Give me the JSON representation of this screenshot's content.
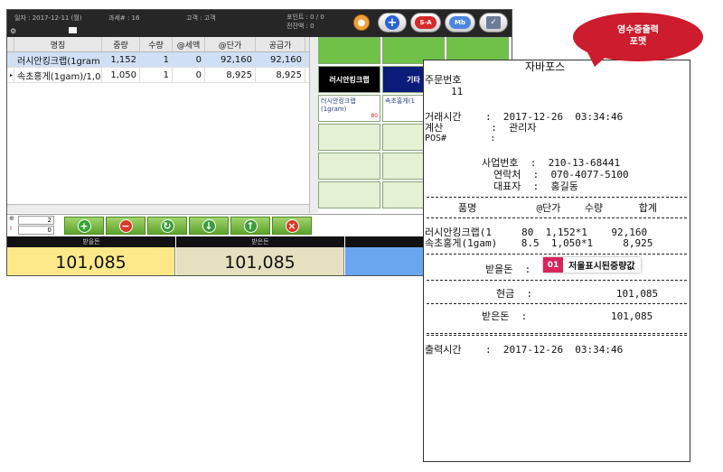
{
  "header": {
    "date_label": "일자 : 2017-12-11 (월)",
    "tax_label": "과세# : 16",
    "customer_label": "고객 : 고객",
    "points_label": "포인트 : 0 / 0",
    "prev_balance_label": "전잔액 : 0",
    "toolbar_sa": "S-A",
    "toolbar_mb": "Mb"
  },
  "table": {
    "columns": [
      "명칭",
      "중량",
      "수량",
      "@세액",
      "@단가",
      "공급가"
    ],
    "rows": [
      [
        "러시안킹크랩(1gram",
        "1,152",
        "1",
        "0",
        "92,160",
        "92,160"
      ],
      [
        "속초홍게(1gam)/1,0",
        "1,050",
        "1",
        "0",
        "8,925",
        "8,925"
      ]
    ]
  },
  "grid": {
    "btn_russian": "러시안킹크랩",
    "btn_other": "기타",
    "prod_russian_name": "러시안킹크랩(1gram)",
    "prod_russian_price": "80",
    "prod_hongge_name": "속초홍게(1"
  },
  "controls": {
    "qty_top": "2",
    "qty_bottom": "0"
  },
  "totals": {
    "label_receivable": "받을돈",
    "value_receivable": "101,085",
    "label_received": "받은돈",
    "value_received": "101,085",
    "label_change": "거스"
  },
  "receipt": {
    "store": "자바포스",
    "order_no_label": "주문번호",
    "order_no": "11",
    "trade_time": "거래시간    :  2017-12-26  03:34:46",
    "cashier": "계산        :  관리자",
    "pos_no": "POS#        :",
    "biz_no": "사업번호  :  210-13-68441",
    "contact": "연락처  :  070-4077-5100",
    "ceo": "대표자  :  홍길동",
    "col_headers": "품명          @단가    수량      합계",
    "item1": "러시안킹크랩(1     80  1,152*1    92,160",
    "item2": "속초홍게(1gam)    8.5  1,050*1     8,925",
    "receivable_label": "받을돈  :",
    "cash": "현금  :              101,085",
    "received": "받은돈  :              101,085",
    "print_time": "출력시간    :  2017-12-26  03:34:46"
  },
  "callout": {
    "line1": "영수증출력",
    "line2": "포맷"
  },
  "marker": {
    "number": "01",
    "text": "저울표시된중량값"
  },
  "colors": {
    "callout": "#cc1c2d",
    "marker": "#d6255b",
    "receivable_bg": "#fde98a",
    "received_bg": "#e6e0c0",
    "change_bg": "#6aa6f0"
  }
}
